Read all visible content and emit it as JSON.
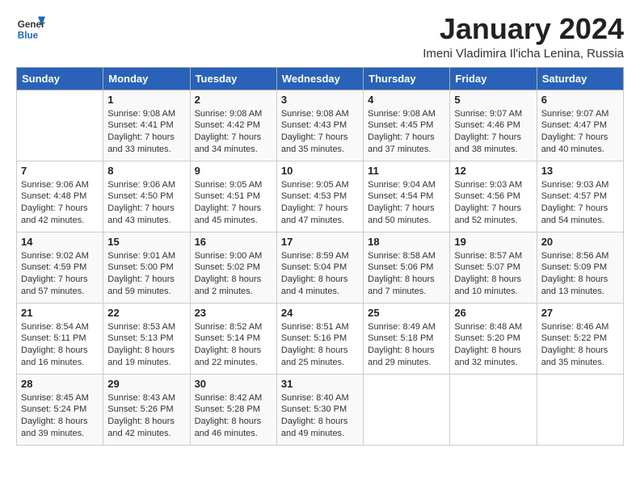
{
  "logo": {
    "line1": "General",
    "line2": "Blue"
  },
  "title": "January 2024",
  "subtitle": "Imeni Vladimira Il'icha Lenina, Russia",
  "weekdays": [
    "Sunday",
    "Monday",
    "Tuesday",
    "Wednesday",
    "Thursday",
    "Friday",
    "Saturday"
  ],
  "weeks": [
    [
      {
        "day": "",
        "sunrise": "",
        "sunset": "",
        "daylight": ""
      },
      {
        "day": "1",
        "sunrise": "Sunrise: 9:08 AM",
        "sunset": "Sunset: 4:41 PM",
        "daylight": "Daylight: 7 hours and 33 minutes."
      },
      {
        "day": "2",
        "sunrise": "Sunrise: 9:08 AM",
        "sunset": "Sunset: 4:42 PM",
        "daylight": "Daylight: 7 hours and 34 minutes."
      },
      {
        "day": "3",
        "sunrise": "Sunrise: 9:08 AM",
        "sunset": "Sunset: 4:43 PM",
        "daylight": "Daylight: 7 hours and 35 minutes."
      },
      {
        "day": "4",
        "sunrise": "Sunrise: 9:08 AM",
        "sunset": "Sunset: 4:45 PM",
        "daylight": "Daylight: 7 hours and 37 minutes."
      },
      {
        "day": "5",
        "sunrise": "Sunrise: 9:07 AM",
        "sunset": "Sunset: 4:46 PM",
        "daylight": "Daylight: 7 hours and 38 minutes."
      },
      {
        "day": "6",
        "sunrise": "Sunrise: 9:07 AM",
        "sunset": "Sunset: 4:47 PM",
        "daylight": "Daylight: 7 hours and 40 minutes."
      }
    ],
    [
      {
        "day": "7",
        "sunrise": "Sunrise: 9:06 AM",
        "sunset": "Sunset: 4:48 PM",
        "daylight": "Daylight: 7 hours and 42 minutes."
      },
      {
        "day": "8",
        "sunrise": "Sunrise: 9:06 AM",
        "sunset": "Sunset: 4:50 PM",
        "daylight": "Daylight: 7 hours and 43 minutes."
      },
      {
        "day": "9",
        "sunrise": "Sunrise: 9:05 AM",
        "sunset": "Sunset: 4:51 PM",
        "daylight": "Daylight: 7 hours and 45 minutes."
      },
      {
        "day": "10",
        "sunrise": "Sunrise: 9:05 AM",
        "sunset": "Sunset: 4:53 PM",
        "daylight": "Daylight: 7 hours and 47 minutes."
      },
      {
        "day": "11",
        "sunrise": "Sunrise: 9:04 AM",
        "sunset": "Sunset: 4:54 PM",
        "daylight": "Daylight: 7 hours and 50 minutes."
      },
      {
        "day": "12",
        "sunrise": "Sunrise: 9:03 AM",
        "sunset": "Sunset: 4:56 PM",
        "daylight": "Daylight: 7 hours and 52 minutes."
      },
      {
        "day": "13",
        "sunrise": "Sunrise: 9:03 AM",
        "sunset": "Sunset: 4:57 PM",
        "daylight": "Daylight: 7 hours and 54 minutes."
      }
    ],
    [
      {
        "day": "14",
        "sunrise": "Sunrise: 9:02 AM",
        "sunset": "Sunset: 4:59 PM",
        "daylight": "Daylight: 7 hours and 57 minutes."
      },
      {
        "day": "15",
        "sunrise": "Sunrise: 9:01 AM",
        "sunset": "Sunset: 5:00 PM",
        "daylight": "Daylight: 7 hours and 59 minutes."
      },
      {
        "day": "16",
        "sunrise": "Sunrise: 9:00 AM",
        "sunset": "Sunset: 5:02 PM",
        "daylight": "Daylight: 8 hours and 2 minutes."
      },
      {
        "day": "17",
        "sunrise": "Sunrise: 8:59 AM",
        "sunset": "Sunset: 5:04 PM",
        "daylight": "Daylight: 8 hours and 4 minutes."
      },
      {
        "day": "18",
        "sunrise": "Sunrise: 8:58 AM",
        "sunset": "Sunset: 5:06 PM",
        "daylight": "Daylight: 8 hours and 7 minutes."
      },
      {
        "day": "19",
        "sunrise": "Sunrise: 8:57 AM",
        "sunset": "Sunset: 5:07 PM",
        "daylight": "Daylight: 8 hours and 10 minutes."
      },
      {
        "day": "20",
        "sunrise": "Sunrise: 8:56 AM",
        "sunset": "Sunset: 5:09 PM",
        "daylight": "Daylight: 8 hours and 13 minutes."
      }
    ],
    [
      {
        "day": "21",
        "sunrise": "Sunrise: 8:54 AM",
        "sunset": "Sunset: 5:11 PM",
        "daylight": "Daylight: 8 hours and 16 minutes."
      },
      {
        "day": "22",
        "sunrise": "Sunrise: 8:53 AM",
        "sunset": "Sunset: 5:13 PM",
        "daylight": "Daylight: 8 hours and 19 minutes."
      },
      {
        "day": "23",
        "sunrise": "Sunrise: 8:52 AM",
        "sunset": "Sunset: 5:14 PM",
        "daylight": "Daylight: 8 hours and 22 minutes."
      },
      {
        "day": "24",
        "sunrise": "Sunrise: 8:51 AM",
        "sunset": "Sunset: 5:16 PM",
        "daylight": "Daylight: 8 hours and 25 minutes."
      },
      {
        "day": "25",
        "sunrise": "Sunrise: 8:49 AM",
        "sunset": "Sunset: 5:18 PM",
        "daylight": "Daylight: 8 hours and 29 minutes."
      },
      {
        "day": "26",
        "sunrise": "Sunrise: 8:48 AM",
        "sunset": "Sunset: 5:20 PM",
        "daylight": "Daylight: 8 hours and 32 minutes."
      },
      {
        "day": "27",
        "sunrise": "Sunrise: 8:46 AM",
        "sunset": "Sunset: 5:22 PM",
        "daylight": "Daylight: 8 hours and 35 minutes."
      }
    ],
    [
      {
        "day": "28",
        "sunrise": "Sunrise: 8:45 AM",
        "sunset": "Sunset: 5:24 PM",
        "daylight": "Daylight: 8 hours and 39 minutes."
      },
      {
        "day": "29",
        "sunrise": "Sunrise: 8:43 AM",
        "sunset": "Sunset: 5:26 PM",
        "daylight": "Daylight: 8 hours and 42 minutes."
      },
      {
        "day": "30",
        "sunrise": "Sunrise: 8:42 AM",
        "sunset": "Sunset: 5:28 PM",
        "daylight": "Daylight: 8 hours and 46 minutes."
      },
      {
        "day": "31",
        "sunrise": "Sunrise: 8:40 AM",
        "sunset": "Sunset: 5:30 PM",
        "daylight": "Daylight: 8 hours and 49 minutes."
      },
      {
        "day": "",
        "sunrise": "",
        "sunset": "",
        "daylight": ""
      },
      {
        "day": "",
        "sunrise": "",
        "sunset": "",
        "daylight": ""
      },
      {
        "day": "",
        "sunrise": "",
        "sunset": "",
        "daylight": ""
      }
    ]
  ]
}
